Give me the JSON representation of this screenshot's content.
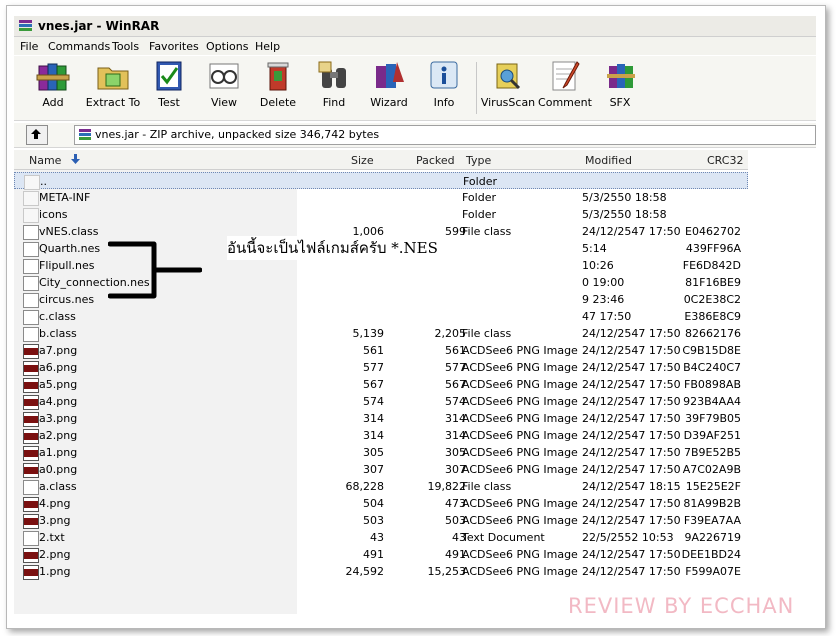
{
  "window": {
    "title": "vnes.jar - WinRAR"
  },
  "menu": [
    "File",
    "Commands",
    "Tools",
    "Favorites",
    "Options",
    "Help"
  ],
  "toolbar": [
    {
      "label": "Add",
      "icon": "add-books-icon"
    },
    {
      "label": "Extract To",
      "icon": "extract-folder-icon"
    },
    {
      "label": "Test",
      "icon": "test-check-icon"
    },
    {
      "label": "View",
      "icon": "view-glasses-icon"
    },
    {
      "label": "Delete",
      "icon": "delete-icon"
    },
    {
      "label": "Find",
      "icon": "find-binoculars-icon"
    },
    {
      "label": "Wizard",
      "icon": "wizard-icon"
    },
    {
      "label": "Info",
      "icon": "info-icon"
    },
    {
      "label": "VirusScan",
      "icon": "virus-scan-icon"
    },
    {
      "label": "Comment",
      "icon": "comment-icon"
    },
    {
      "label": "SFX",
      "icon": "sfx-icon"
    }
  ],
  "address": {
    "text": "vnes.jar - ZIP archive, unpacked size 346,742 bytes"
  },
  "columns": {
    "name": "Name",
    "size": "Size",
    "packed": "Packed",
    "type": "Type",
    "modified": "Modified",
    "crc": "CRC32"
  },
  "rows": [
    {
      "name": "..",
      "size": "",
      "packed": "",
      "type": "Folder",
      "modified": "",
      "crc": "",
      "icon": "folder-icon",
      "selected": true
    },
    {
      "name": "META-INF",
      "size": "",
      "packed": "",
      "type": "Folder",
      "modified": "5/3/2550 18:58",
      "crc": "",
      "icon": "folder-icon"
    },
    {
      "name": "icons",
      "size": "",
      "packed": "",
      "type": "Folder",
      "modified": "5/3/2550 18:58",
      "crc": "",
      "icon": "folder-icon"
    },
    {
      "name": "vNES.class",
      "size": "1,006",
      "packed": "599",
      "type": "File class",
      "modified": "24/12/2547 17:50",
      "crc": "E0462702",
      "icon": "file-icon"
    },
    {
      "name": "Quarth.nes",
      "size": "",
      "packed": "",
      "type": "",
      "modified": "5:14",
      "crc": "439FF96A",
      "icon": "file-icon"
    },
    {
      "name": "Flipull.nes",
      "size": "",
      "packed": "",
      "type": "",
      "modified": "10:26",
      "crc": "FE6D842D",
      "icon": "file-icon"
    },
    {
      "name": "City_connection.nes",
      "size": "",
      "packed": "",
      "type": "",
      "modified": "0 19:00",
      "crc": "81F16BE9",
      "icon": "file-icon"
    },
    {
      "name": "circus.nes",
      "size": "",
      "packed": "",
      "type": "",
      "modified": "9 23:46",
      "crc": "0C2E38C2",
      "icon": "file-icon"
    },
    {
      "name": "c.class",
      "size": "",
      "packed": "",
      "type": "",
      "modified": "47 17:50",
      "crc": "E386E8C9",
      "icon": "file-icon"
    },
    {
      "name": "b.class",
      "size": "5,139",
      "packed": "2,205",
      "type": "File class",
      "modified": "24/12/2547 17:50",
      "crc": "82662176",
      "icon": "file-icon"
    },
    {
      "name": "a7.png",
      "size": "561",
      "packed": "561",
      "type": "ACDSee6 PNG Image",
      "modified": "24/12/2547 17:50",
      "crc": "C9B15D8E",
      "icon": "png-icon"
    },
    {
      "name": "a6.png",
      "size": "577",
      "packed": "577",
      "type": "ACDSee6 PNG Image",
      "modified": "24/12/2547 17:50",
      "crc": "B4C240C7",
      "icon": "png-icon"
    },
    {
      "name": "a5.png",
      "size": "567",
      "packed": "567",
      "type": "ACDSee6 PNG Image",
      "modified": "24/12/2547 17:50",
      "crc": "FB0898AB",
      "icon": "png-icon"
    },
    {
      "name": "a4.png",
      "size": "574",
      "packed": "574",
      "type": "ACDSee6 PNG Image",
      "modified": "24/12/2547 17:50",
      "crc": "923B4AA4",
      "icon": "png-icon"
    },
    {
      "name": "a3.png",
      "size": "314",
      "packed": "314",
      "type": "ACDSee6 PNG Image",
      "modified": "24/12/2547 17:50",
      "crc": "39F79B05",
      "icon": "png-icon"
    },
    {
      "name": "a2.png",
      "size": "314",
      "packed": "314",
      "type": "ACDSee6 PNG Image",
      "modified": "24/12/2547 17:50",
      "crc": "D39AF251",
      "icon": "png-icon"
    },
    {
      "name": "a1.png",
      "size": "305",
      "packed": "305",
      "type": "ACDSee6 PNG Image",
      "modified": "24/12/2547 17:50",
      "crc": "7B9E52B5",
      "icon": "png-icon"
    },
    {
      "name": "a0.png",
      "size": "307",
      "packed": "307",
      "type": "ACDSee6 PNG Image",
      "modified": "24/12/2547 17:50",
      "crc": "A7C02A9B",
      "icon": "png-icon"
    },
    {
      "name": "a.class",
      "size": "68,228",
      "packed": "19,822",
      "type": "File class",
      "modified": "24/12/2547 18:15",
      "crc": "15E25E2F",
      "icon": "file-icon"
    },
    {
      "name": "4.png",
      "size": "504",
      "packed": "473",
      "type": "ACDSee6 PNG Image",
      "modified": "24/12/2547 17:50",
      "crc": "81A99B2B",
      "icon": "png-icon"
    },
    {
      "name": "3.png",
      "size": "503",
      "packed": "503",
      "type": "ACDSee6 PNG Image",
      "modified": "24/12/2547 17:50",
      "crc": "F39EA7AA",
      "icon": "png-icon"
    },
    {
      "name": "2.txt",
      "size": "43",
      "packed": "43",
      "type": "Text Document",
      "modified": "22/5/2552 10:53",
      "crc": "9A226719",
      "icon": "text-file-icon"
    },
    {
      "name": "2.png",
      "size": "491",
      "packed": "491",
      "type": "ACDSee6 PNG Image",
      "modified": "24/12/2547 17:50",
      "crc": "DEE1BD24",
      "icon": "png-icon"
    },
    {
      "name": "1.png",
      "size": "24,592",
      "packed": "15,253",
      "type": "ACDSee6 PNG Image",
      "modified": "24/12/2547 17:50",
      "crc": "F599A07E",
      "icon": "png-icon"
    }
  ],
  "annotation": {
    "text": "อันนี้จะเป็นไฟล์เกมส์ครับ *.NES"
  },
  "watermark": {
    "text": "REVIEW BY ECCHAN"
  }
}
